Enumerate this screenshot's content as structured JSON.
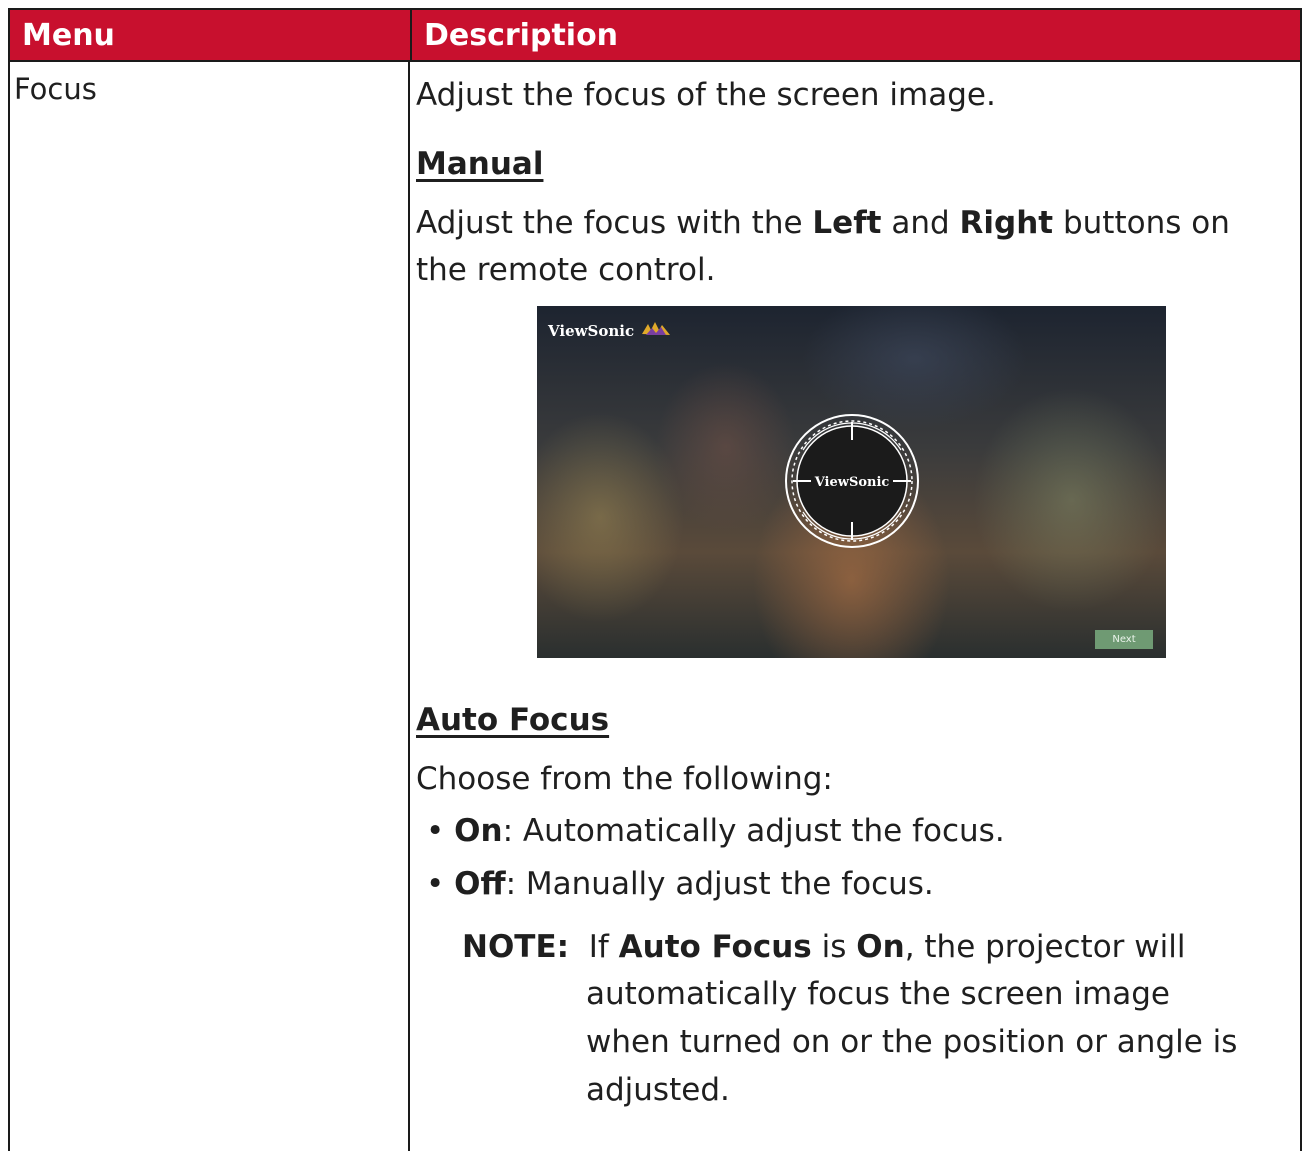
{
  "header": {
    "col_menu": "Menu",
    "col_description": "Description"
  },
  "row": {
    "menu": "Focus",
    "intro": "Adjust the focus of the screen image.",
    "manual": {
      "heading": "Manual",
      "line1_a": "Adjust the focus with the ",
      "line1_b": "Left",
      "line1_c": " and ",
      "line1_d": "Right",
      "line1_e": " buttons on",
      "line2": "the remote control."
    },
    "screenshot": {
      "brand": "ViewSonic",
      "center_brand": "ViewSonic",
      "next_label": "Next"
    },
    "auto_focus": {
      "heading": "Auto Focus",
      "choose": "Choose from the following:",
      "options": [
        {
          "name": "On",
          "text": ": Automatically adjust the focus."
        },
        {
          "name": "Off",
          "text": ": Manually adjust the focus."
        }
      ],
      "note": {
        "label": "NOTE:",
        "l1_a": "If ",
        "l1_b": "Auto Focus",
        "l1_c": " is ",
        "l1_d": "On",
        "l1_e": ", the projector will",
        "l2": "automatically focus the screen image",
        "l3": "when turned on or the position or angle is",
        "l4": "adjusted."
      }
    }
  },
  "colors": {
    "header_bg": "#c8102e",
    "next_button": "#6f9a73"
  }
}
